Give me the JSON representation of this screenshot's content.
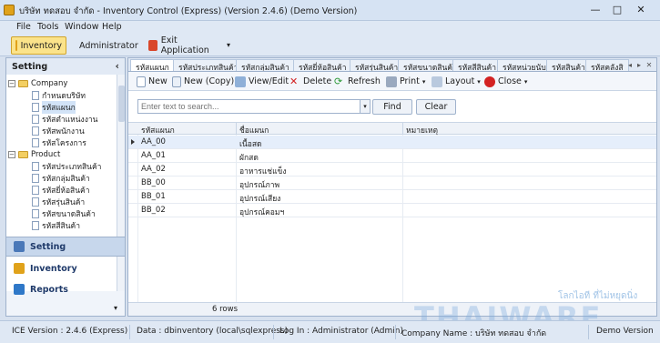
{
  "window": {
    "title": "บริษัท ทดสอบ จำกัด - Inventory Control (Express) (Version 2.4.6) (Demo Version)",
    "controls": {
      "minimize": "—",
      "maximize": "□",
      "close": "✕"
    }
  },
  "menu": [
    "File",
    "Tools",
    "Window",
    "Help"
  ],
  "toolbar": {
    "inventory": "Inventory",
    "administrator": "Administrator",
    "exit": "Exit Application"
  },
  "sidebar": {
    "title": "Setting",
    "collapse": "‹",
    "tree": [
      {
        "label": "Company",
        "type": "folder",
        "expander": "−"
      },
      {
        "label": "กำหนดบริษัท",
        "type": "item"
      },
      {
        "label": "รหัสแผนก",
        "type": "item",
        "selected": true
      },
      {
        "label": "รหัสตำแหน่งงาน",
        "type": "item"
      },
      {
        "label": "รหัสพนักงาน",
        "type": "item"
      },
      {
        "label": "รหัสโครงการ",
        "type": "item"
      },
      {
        "label": "Product",
        "type": "folder",
        "expander": "−"
      },
      {
        "label": "รหัสประเภทสินค้า",
        "type": "item"
      },
      {
        "label": "รหัสกลุ่มสินค้า",
        "type": "item"
      },
      {
        "label": "รหัสยี่ห้อสินค้า",
        "type": "item"
      },
      {
        "label": "รหัสรุ่นสินค้า",
        "type": "item"
      },
      {
        "label": "รหัสขนาดสินค้า",
        "type": "item"
      },
      {
        "label": "รหัสสีสินค้า",
        "type": "item"
      }
    ],
    "nav": [
      {
        "label": "Setting",
        "active": true,
        "icon": "gear-icon",
        "color": "#4a78b8"
      },
      {
        "label": "Inventory",
        "active": false,
        "icon": "box-icon",
        "color": "#e0a21a"
      },
      {
        "label": "Reports",
        "active": false,
        "icon": "report-icon",
        "color": "#2f78c8"
      }
    ],
    "more": "▾"
  },
  "tabs": [
    "รหัสแผนก",
    "รหัสประเภทสินค้า",
    "รหัสกลุ่มสินค้า",
    "รหัสยี่ห้อสินค้า",
    "รหัสรุ่นสินค้า",
    "รหัสขนาดสินค้า",
    "รหัสสีสินค้า",
    "รหัสหน่วยนับ",
    "รหัสสินค้า",
    "รหัสคลังสิ"
  ],
  "tab_nav": {
    "prev": "◂",
    "next": "▸",
    "close": "✕"
  },
  "actions": {
    "new": "New",
    "new_copy": "New (Copy)",
    "view_edit": "View/Edit",
    "delete": "Delete",
    "refresh": "Refresh",
    "print": "Print",
    "layout": "Layout",
    "close": "Close"
  },
  "search": {
    "placeholder": "Enter text to search...",
    "find": "Find",
    "clear": "Clear"
  },
  "grid": {
    "columns": [
      "รหัสแผนก",
      "ชื่อแผนก",
      "หมายเหตุ"
    ],
    "rows": [
      [
        "AA_00",
        "เนื้อสด",
        ""
      ],
      [
        "AA_01",
        "ผักสด",
        ""
      ],
      [
        "AA_02",
        "อาหารแช่แข็ง",
        ""
      ],
      [
        "BB_00",
        "อุปกรณ์ภาพ",
        ""
      ],
      [
        "BB_01",
        "อุปกรณ์เสียง",
        ""
      ],
      [
        "BB_02",
        "อุปกรณ์คอมฯ",
        ""
      ]
    ],
    "row_count": "6 rows"
  },
  "status": {
    "version": "ICE Version : 2.4.6 (Express)",
    "data": "Data : dbinventory (local\\sqlexpress)",
    "login": "Log In : Administrator (Admin)",
    "company": "Company Name : บริษัท ทดสอบ จำกัด",
    "mode": "Demo Version"
  },
  "watermark": {
    "brand": "THAIWARE",
    "tagline": "โลกไอที ที่ไม่หยุดนิ่ง"
  },
  "colors": {
    "accent": "#fbe38a",
    "selection": "#d2e3f7",
    "border": "#9fb2cc"
  }
}
